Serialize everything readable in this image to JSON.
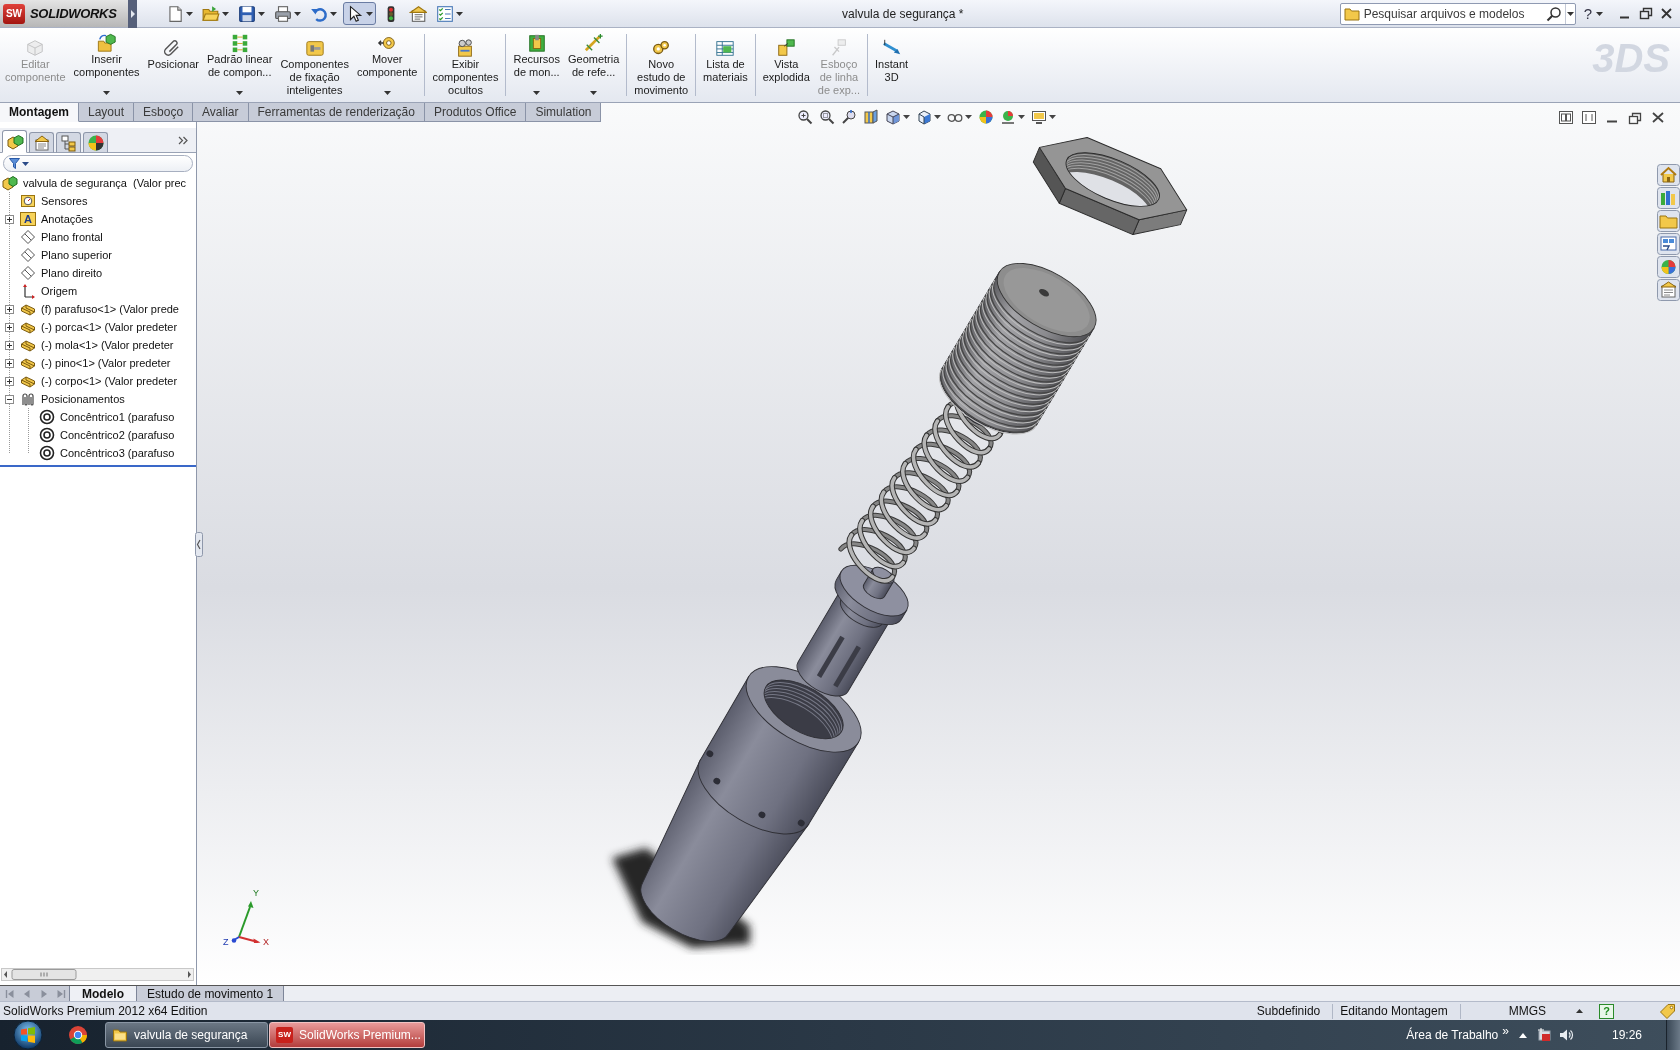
{
  "app_menu": {
    "badge": "SW",
    "logo": "SOLIDWORKS"
  },
  "quick_access": [
    {
      "kind": "new",
      "dropdown": true,
      "selected": false
    },
    {
      "kind": "open",
      "dropdown": true,
      "selected": false
    },
    {
      "kind": "save",
      "dropdown": true,
      "selected": false
    },
    {
      "kind": "print",
      "dropdown": true,
      "selected": false
    },
    {
      "kind": "undo",
      "dropdown": true,
      "selected": false
    },
    {
      "kind": "select",
      "dropdown": true,
      "selected": true
    },
    {
      "kind": "rebuild",
      "dropdown": false,
      "selected": false
    },
    {
      "kind": "file-properties",
      "dropdown": false,
      "selected": false
    },
    {
      "kind": "options",
      "dropdown": true,
      "selected": false
    }
  ],
  "window": {
    "title": "valvula de segurança *",
    "help": "?"
  },
  "search": {
    "placeholder": "Pesquisar arquivos e modelos"
  },
  "command_groups": [
    [
      {
        "kind": "edit-component",
        "label": "Editar\ncomponente",
        "disabled": true,
        "dropdown": false
      },
      {
        "kind": "insert-components",
        "label": "Inserir\ncomponentes",
        "disabled": false,
        "dropdown": true
      },
      {
        "kind": "mate",
        "label": "Posicionar",
        "disabled": false,
        "dropdown": false
      },
      {
        "kind": "linear-pattern",
        "label": "Padrão linear\nde compon...",
        "disabled": false,
        "dropdown": true
      },
      {
        "kind": "smart-fasteners",
        "label": "Componentes\nde fixação\ninteligentes",
        "disabled": false,
        "dropdown": false
      },
      {
        "kind": "move-component",
        "label": "Mover\ncomponente",
        "disabled": false,
        "dropdown": true
      }
    ],
    [
      {
        "kind": "show-hidden",
        "label": "Exibir\ncomponentes\nocultos",
        "disabled": false,
        "dropdown": false
      }
    ],
    [
      {
        "kind": "assembly-features",
        "label": "Recursos\nde mon...",
        "disabled": false,
        "dropdown": true
      },
      {
        "kind": "reference-geometry",
        "label": "Geometria\nde refe...",
        "disabled": false,
        "dropdown": true
      }
    ],
    [
      {
        "kind": "motion-study",
        "label": "Novo\nestudo de\nmovimento",
        "disabled": false,
        "dropdown": false
      }
    ],
    [
      {
        "kind": "bill-of-materials",
        "label": "Lista de\nmateriais",
        "disabled": false,
        "dropdown": false
      }
    ],
    [
      {
        "kind": "exploded-view",
        "label": "Vista\nexplodida",
        "disabled": false,
        "dropdown": false
      },
      {
        "kind": "explode-line-sketch",
        "label": "Esboço\nde linha\nde exp...",
        "disabled": true,
        "dropdown": false
      }
    ],
    [
      {
        "kind": "instant-3d",
        "label": "Instant\n3D",
        "disabled": false,
        "dropdown": false
      }
    ]
  ],
  "brand_mark": "3DS",
  "command_tabs": [
    {
      "label": "Montagem",
      "selected": true
    },
    {
      "label": "Layout",
      "selected": false
    },
    {
      "label": "Esboço",
      "selected": false
    },
    {
      "label": "Avaliar",
      "selected": false
    },
    {
      "label": "Ferramentas de renderização",
      "selected": false
    },
    {
      "label": "Produtos Office",
      "selected": false
    },
    {
      "label": "Simulation",
      "selected": false
    }
  ],
  "panel_tabs": [
    {
      "kind": "feature-manager",
      "selected": true
    },
    {
      "kind": "property-manager",
      "selected": false
    },
    {
      "kind": "configuration-manager",
      "selected": false
    },
    {
      "kind": "display-manager",
      "selected": false
    }
  ],
  "feature_tree": {
    "label": "valvula de segurança  (Valor prec",
    "kind": "assembly",
    "children": [
      {
        "label": "Sensores",
        "kind": "sensors"
      },
      {
        "label": "Anotações",
        "badge": "A",
        "expanded": false
      },
      {
        "label": "Plano frontal",
        "kind": "plane"
      },
      {
        "label": "Plano superior",
        "kind": "plane"
      },
      {
        "label": "Plano direito",
        "kind": "plane"
      },
      {
        "label": "Origem",
        "kind": "origin"
      },
      {
        "label": "(f) parafuso<1> (Valor prede",
        "kind": "part",
        "expanded": false
      },
      {
        "label": "(-) porca<1> (Valor predeter",
        "kind": "part",
        "expanded": false
      },
      {
        "label": "(-) mola<1> (Valor predeter",
        "kind": "part",
        "expanded": false
      },
      {
        "label": "(-) pino<1> (Valor predeter",
        "kind": "part",
        "expanded": false
      },
      {
        "label": "(-) corpo<1> (Valor predeter",
        "kind": "part",
        "expanded": false
      },
      {
        "label": "Posicionamentos",
        "kind": "mates",
        "expanded": true,
        "children": [
          {
            "label": "Concêntrico1 (parafuso",
            "kind": "concentric-mate"
          },
          {
            "label": "Concêntrico2 (parafuso",
            "kind": "concentric-mate"
          },
          {
            "label": "Concêntrico3 (parafuso",
            "kind": "concentric-mate"
          }
        ]
      }
    ]
  },
  "axis_triad": {
    "x": "X",
    "y": "Y",
    "z": "Z"
  },
  "bottom_tabs": [
    {
      "label": "Modelo",
      "selected": true
    },
    {
      "label": "Estudo de movimento 1",
      "selected": false
    }
  ],
  "status_bar": {
    "edition": "SolidWorks Premium 2012 x64 Edition",
    "state": "Subdefinido",
    "mode": "Editando Montagem",
    "units": "MMGS",
    "help": "?"
  },
  "taskbar": {
    "buttons": [
      {
        "kind": "folder",
        "label": "valvula de segurança",
        "selected": false
      },
      {
        "kind": "app",
        "badge": "SW",
        "label": "SolidWorks Premium...",
        "selected": true
      }
    ],
    "toolbar": "Área de Trabalho",
    "chevron": "»",
    "clock": "19:26"
  }
}
